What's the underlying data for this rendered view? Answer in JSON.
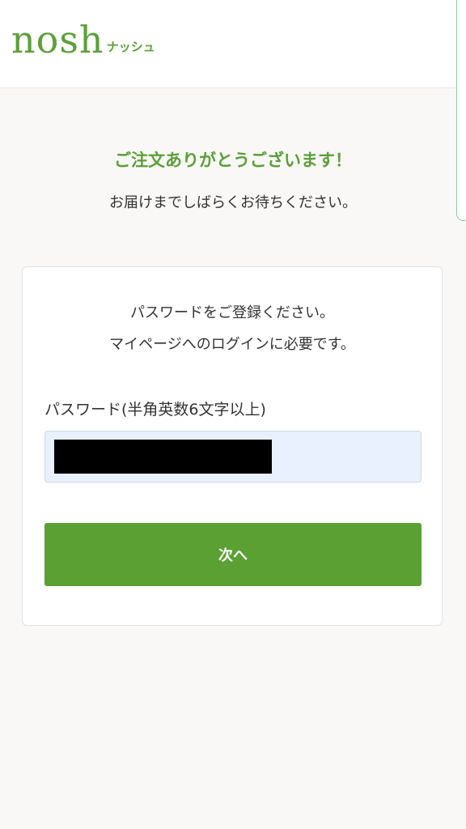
{
  "header": {
    "logo_text": "nosh",
    "logo_sub": "ナッシュ"
  },
  "thanks": {
    "title": "ご注文ありがとうございます！",
    "subtitle": "お届けまでしばらくお待ちください。"
  },
  "card": {
    "line1": "パスワードをご登録ください。",
    "line2": "マイページへのログインに必要です。",
    "field_label": "パスワード(半角英数6文字以上)",
    "next_label": "次へ"
  },
  "colors": {
    "brand_green": "#5ba03a",
    "input_bg": "#e8f1fd",
    "button_bg": "#5aa033"
  }
}
